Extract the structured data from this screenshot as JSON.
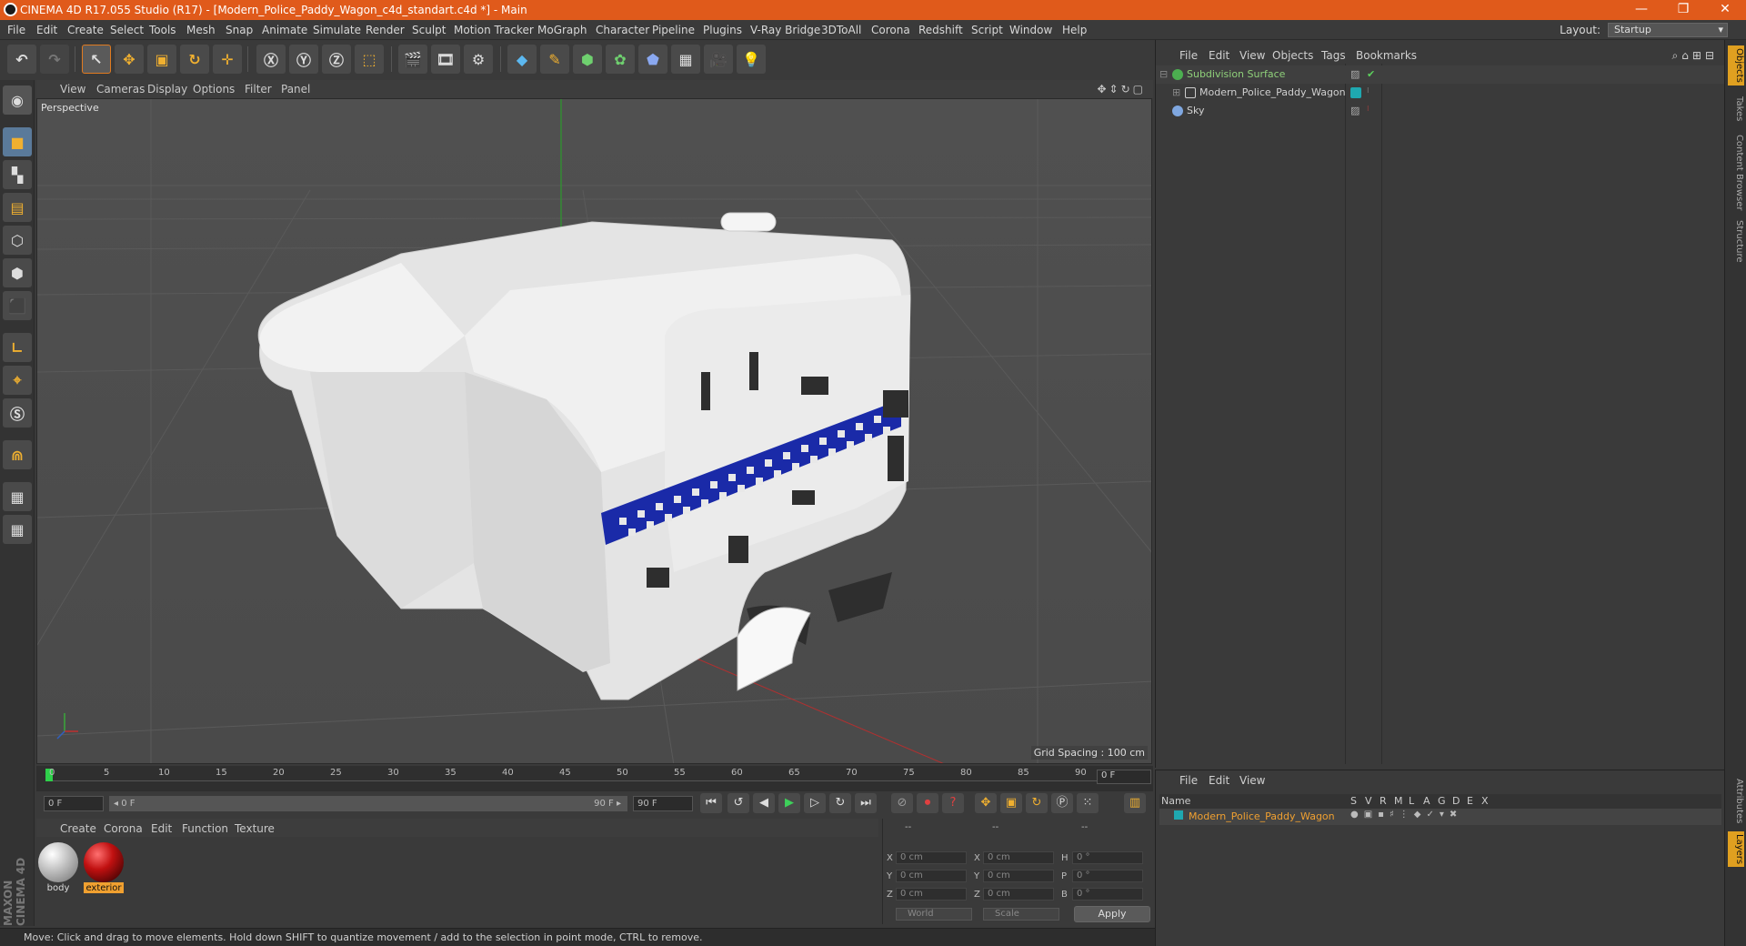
{
  "window": {
    "title": "CINEMA 4D R17.055 Studio (R17) - [Modern_Police_Paddy_Wagon_c4d_standart.c4d *] - Main",
    "minimize": "—",
    "restore": "❐",
    "close": "✕"
  },
  "menubar": {
    "items": [
      "File",
      "Edit",
      "Create",
      "Select",
      "Tools",
      "Mesh",
      "Snap",
      "Animate",
      "Simulate",
      "Render",
      "Sculpt",
      "Motion Tracker",
      "MoGraph",
      "Character",
      "Pipeline",
      "Plugins",
      "V-Ray Bridge",
      "3DToAll",
      "Corona",
      "Redshift",
      "Script",
      "Window",
      "Help"
    ],
    "layout_label": "Layout:",
    "layout_value": "Startup"
  },
  "viewport": {
    "menu": [
      "View",
      "Cameras",
      "Display",
      "Options",
      "Filter",
      "Panel"
    ],
    "label": "Perspective",
    "grid_spacing": "Grid Spacing : 100 cm"
  },
  "timeline": {
    "ticks": [
      "0",
      "5",
      "10",
      "15",
      "20",
      "25",
      "30",
      "35",
      "40",
      "45",
      "50",
      "55",
      "60",
      "65",
      "70",
      "75",
      "80",
      "85",
      "90"
    ],
    "current_frame": "0 F",
    "start_field": "0 F",
    "range_start": "◂ 0 F",
    "range_end": "90 F ▸",
    "end_field": "90 F"
  },
  "materials": {
    "menu": [
      "Create",
      "Corona",
      "Edit",
      "Function",
      "Texture"
    ],
    "items": [
      {
        "name": "body",
        "selected": false
      },
      {
        "name": "exterior",
        "selected": true
      }
    ]
  },
  "coordinates": {
    "headers": [
      "--",
      "--",
      "--"
    ],
    "rows": [
      {
        "a": "X",
        "av": "0 cm",
        "b": "X",
        "bv": "0 cm",
        "c": "H",
        "cv": "0 °"
      },
      {
        "a": "Y",
        "av": "0 cm",
        "b": "Y",
        "bv": "0 cm",
        "c": "P",
        "cv": "0 °"
      },
      {
        "a": "Z",
        "av": "0 cm",
        "b": "Z",
        "bv": "0 cm",
        "c": "B",
        "cv": "0 °"
      }
    ],
    "mode": "World",
    "scale": "Scale",
    "apply": "Apply"
  },
  "status": "Move: Click and drag to move elements. Hold down SHIFT to quantize movement / add to the selection in point mode, CTRL to remove.",
  "objects": {
    "menu": [
      "File",
      "Edit",
      "View",
      "Objects",
      "Tags",
      "Bookmarks"
    ],
    "items": [
      {
        "name": "Subdivision Surface",
        "color": "#8fd07a"
      },
      {
        "name": "Modern_Police_Paddy_Wagon",
        "color": "#cfcfcf"
      },
      {
        "name": "Sky",
        "color": "#7fa7e0"
      }
    ]
  },
  "layers": {
    "menu": [
      "File",
      "Edit",
      "View"
    ],
    "columns": [
      "Name",
      "S",
      "V",
      "R",
      "M",
      "L",
      "A",
      "G",
      "D",
      "E",
      "X"
    ],
    "row_name": "Modern_Police_Paddy_Wagon",
    "row_color": "#f0a030"
  },
  "right_tabs": [
    "Objects",
    "Takes",
    "Content Browser",
    "Structure"
  ],
  "right_tabs_bottom": [
    "Attributes",
    "Layers"
  ],
  "brand": "MAXON CINEMA 4D",
  "accent": "#e05a1b"
}
